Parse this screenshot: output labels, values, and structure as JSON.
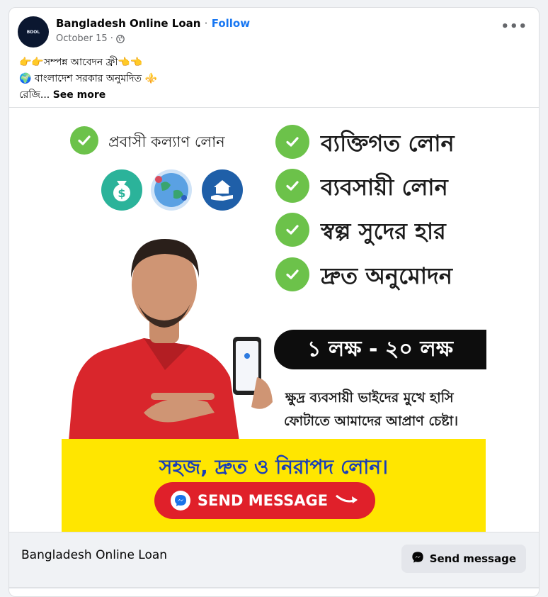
{
  "post": {
    "page_name": "Bangladesh Online Loan",
    "separator": "·",
    "follow_label": "Follow",
    "date": "October 15",
    "separator2": "·",
    "avatar_text": "BDOL",
    "text_line1": "👉👉সম্পন্ন আবেদন ফ্রী👈👈",
    "text_line2": "🌍 বাংলাদেশ সরকার অনুমদিত ⚜️",
    "text_line3_prefix": "রেজি...",
    "see_more": "See more"
  },
  "ad": {
    "items": [
      "প্রবাসী কল্যাণ লোন",
      "ব্যক্তিগত লোন",
      "ব্যবসায়ী লোন",
      "স্বল্প সুদের হার",
      "দ্রুত অনুমোদন"
    ],
    "range": "১ লক্ষ - ২০ লক্ষ",
    "tagline1": "ক্ষুদ্র ব্যবসায়ী ভাইদের মুখে হাসি",
    "tagline2": "ফোটাতে আমাদের আপ্রাণ চেষ্টা।",
    "slogan": "সহজ, দ্রুত ও নিরাপদ লোন।",
    "send_button": "SEND MESSAGE"
  },
  "footer": {
    "title": "Bangladesh Online Loan",
    "button": "Send message"
  },
  "colors": {
    "accent": "#1877f2",
    "check_green": "#6cc24a",
    "ad_yellow": "#ffe600",
    "ad_red": "#e0202a",
    "slogan_blue": "#1a3fb7"
  }
}
